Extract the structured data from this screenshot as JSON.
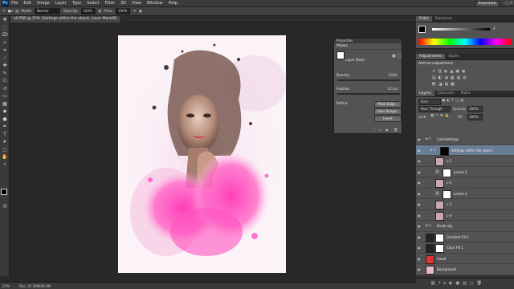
{
  "menubar": {
    "app_icon": "Ps",
    "items": [
      "File",
      "Edit",
      "Image",
      "Layer",
      "Type",
      "Select",
      "Filter",
      "3D",
      "View",
      "Window",
      "Help"
    ],
    "workspace": "Essentials"
  },
  "options": {
    "mode_label": "Mode:",
    "mode_value": "Normal",
    "opacity_label": "Opacity:",
    "opacity_value": "100%",
    "flow_label": "Flow:",
    "flow_value": "100%"
  },
  "document": {
    "tab_title": "all.PSD @ 25% (Settings within the object, Layer Mask/8)"
  },
  "properties": {
    "header": "Properties",
    "title": "Masks",
    "mask_label": "Layer Mask",
    "density_label": "Density:",
    "density_value": "100%",
    "feather_label": "Feather:",
    "feather_value": "0.0 px",
    "refine_label": "Refine:",
    "buttons": [
      "Mask Edge...",
      "Color Range...",
      "Invert"
    ]
  },
  "color_panel": {
    "tabs": [
      "Color",
      "Swatches"
    ],
    "k_value": "0"
  },
  "adjustments": {
    "tabs": [
      "Adjustments",
      "Styles"
    ],
    "title": "Add an adjustment"
  },
  "layers_panel": {
    "tabs": [
      "Layers",
      "Channels",
      "Paths"
    ],
    "kind": "Kind",
    "blend_mode": "Pass Through",
    "opacity_label": "Opacity:",
    "opacity_value": "100%",
    "lock_label": "Lock:",
    "fill_label": "Fill:",
    "fill_value": "100%",
    "layers": [
      {
        "name": "ColorSettings",
        "type": "group",
        "selected": false,
        "indent": 0
      },
      {
        "name": "Settings within the object",
        "type": "group-mask",
        "selected": true,
        "indent": 1
      },
      {
        "name": "c-1",
        "type": "pixel",
        "selected": false,
        "indent": 2
      },
      {
        "name": "Levels 3",
        "type": "adjust",
        "selected": false,
        "indent": 2
      },
      {
        "name": "c-2",
        "type": "pixel",
        "selected": false,
        "indent": 2
      },
      {
        "name": "Levels 4",
        "type": "adjust",
        "selected": false,
        "indent": 2
      },
      {
        "name": "c-3",
        "type": "pixel",
        "selected": false,
        "indent": 2
      },
      {
        "name": "c-4",
        "type": "pixel",
        "selected": false,
        "indent": 2
      },
      {
        "name": "Brush sky",
        "type": "group",
        "selected": false,
        "indent": 0
      },
      {
        "name": "Gradient Fill 1",
        "type": "fill",
        "selected": false,
        "indent": 0
      },
      {
        "name": "Color Fill 1",
        "type": "fill",
        "selected": false,
        "indent": 0
      },
      {
        "name": "Small",
        "type": "pixel-red",
        "selected": false,
        "indent": 0
      },
      {
        "name": "Background",
        "type": "background",
        "selected": false,
        "indent": 0
      }
    ]
  },
  "status": {
    "zoom": "25%",
    "doc": "Doc: 25.5M/800.0M"
  }
}
